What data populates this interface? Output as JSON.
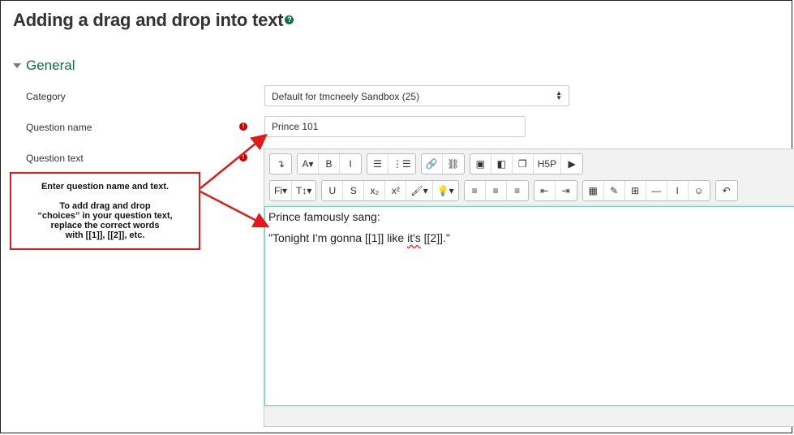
{
  "page": {
    "title": "Adding a drag and drop into text",
    "help_glyph": "?"
  },
  "section": {
    "title": "General"
  },
  "form": {
    "category_label": "Category",
    "category_value": "Default for tmcneely Sandbox (25)",
    "question_name_label": "Question name",
    "question_name_value": "Prince 101",
    "question_text_label": "Question text",
    "required_glyph": "!"
  },
  "toolbar": {
    "row1": [
      {
        "name": "toolbar-toggle-button",
        "glyph": "↴"
      },
      {
        "name": "font-color-button",
        "glyph": "A▾"
      },
      {
        "name": "bold-button",
        "glyph": "B"
      },
      {
        "name": "italic-button",
        "glyph": "I"
      },
      {
        "name": "bullet-list-button",
        "glyph": "☰"
      },
      {
        "name": "numbered-list-button",
        "glyph": "⋮☰"
      },
      {
        "name": "link-button",
        "glyph": "🔗"
      },
      {
        "name": "unlink-button",
        "glyph": "⛓"
      },
      {
        "name": "image-button",
        "glyph": "▣"
      },
      {
        "name": "media-button",
        "glyph": "◧"
      },
      {
        "name": "manage-files-button",
        "glyph": "❐"
      },
      {
        "name": "h5p-button",
        "glyph": "H5P"
      },
      {
        "name": "record-video-button",
        "glyph": "▶"
      }
    ],
    "row2": [
      {
        "name": "font-family-select",
        "glyph": "Fi▾"
      },
      {
        "name": "font-size-select",
        "glyph": "T↕▾"
      },
      {
        "name": "underline-button",
        "glyph": "U"
      },
      {
        "name": "strikethrough-button",
        "glyph": "S"
      },
      {
        "name": "subscript-button",
        "glyph": "x₂"
      },
      {
        "name": "superscript-button",
        "glyph": "x²"
      },
      {
        "name": "background-color-button",
        "glyph": "🖌▾"
      },
      {
        "name": "highlight-button",
        "glyph": "💡▾"
      },
      {
        "name": "align-left-button",
        "glyph": "≡"
      },
      {
        "name": "align-center-button",
        "glyph": "≡"
      },
      {
        "name": "align-right-button",
        "glyph": "≡"
      },
      {
        "name": "outdent-button",
        "glyph": "⇤"
      },
      {
        "name": "indent-button",
        "glyph": "⇥"
      },
      {
        "name": "equation-button",
        "glyph": "▦"
      },
      {
        "name": "edit-html-button",
        "glyph": "✎"
      },
      {
        "name": "table-button",
        "glyph": "⊞"
      },
      {
        "name": "horizontal-rule-button",
        "glyph": "—"
      },
      {
        "name": "cursor-button",
        "glyph": "I"
      },
      {
        "name": "emoticon-button",
        "glyph": "☺"
      },
      {
        "name": "undo-button",
        "glyph": "↶"
      }
    ]
  },
  "editor": {
    "line1": "Prince famously sang:",
    "line2_a": "\"Tonight I'm gonna [[1]] like ",
    "line2_spell": "it's",
    "line2_b": " [[2]].\""
  },
  "callout": {
    "line1": "Enter question name and text.",
    "line2": "To add drag and drop",
    "line3": "“choices” in your question text,",
    "line4": "replace the correct words",
    "line5": "with [[1]], [[2]], etc."
  },
  "colors": {
    "accent": "#0f6e4a",
    "required": "#cc0000",
    "annotation": "#e01b1b"
  }
}
